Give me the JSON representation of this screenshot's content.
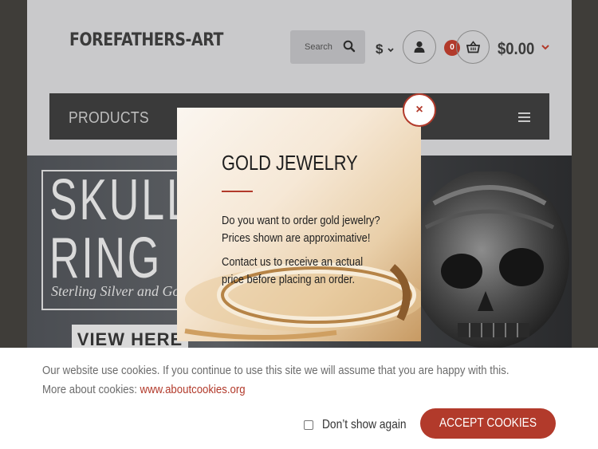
{
  "header": {
    "logo": "FOREFATHERS-ART",
    "search_placeholder": "Search",
    "currency": "$",
    "cart_count": "0",
    "cart_total": "$0.00"
  },
  "nav": {
    "label": "PRODUCTS"
  },
  "banner": {
    "line1": "SKULL",
    "line2": "RING",
    "subtitle": "Sterling Silver and Go",
    "cta": "VIEW HERE"
  },
  "modal": {
    "title": "GOLD JEWELRY",
    "para1_line1": "Do you want to order gold jewelry?",
    "para1_line2": "Prices shown are approximative!",
    "para2_line1": "Contact us to receive an actual",
    "para2_line2": "price before placing an order.",
    "close_label": "×"
  },
  "cookie": {
    "line1": "Our website use cookies. If you continue to use this site we will assume that you are happy with this.",
    "line2_prefix": "More about cookies: ",
    "link": "www.aboutcookies.org",
    "dont_show": "Don’t show again",
    "accept": "ACCEPT COOKIES"
  },
  "colors": {
    "accent": "#b23a2b",
    "navbar": "#3a3a3a",
    "header_bg": "#c9c9cb"
  }
}
